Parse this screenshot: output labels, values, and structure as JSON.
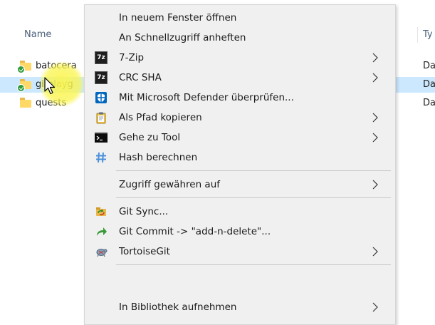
{
  "explorer": {
    "columns": {
      "name": "Name",
      "type": "Ty"
    },
    "rows": [
      {
        "name": "batocera",
        "type": "Da",
        "synced": true,
        "selected": false
      },
      {
        "name": "gitplayg",
        "type": "Da",
        "synced": true,
        "selected": true
      },
      {
        "name": "quests",
        "type": "Da",
        "synced": false,
        "selected": false
      }
    ]
  },
  "context_menu": {
    "items": [
      {
        "label": "In neuem Fenster öffnen",
        "icon": null,
        "submenu": false
      },
      {
        "label": "An Schnellzugriff anheften",
        "icon": null,
        "submenu": false
      },
      {
        "label": "7-Zip",
        "icon": "7zip-icon",
        "submenu": true
      },
      {
        "label": "CRC SHA",
        "icon": "7zip-icon",
        "submenu": true
      },
      {
        "label": "Mit Microsoft Defender überprüfen...",
        "icon": "defender-shield-icon",
        "submenu": false
      },
      {
        "label": "Als Pfad kopieren",
        "icon": "clipboard-icon",
        "submenu": true
      },
      {
        "label": "Gehe zu Tool",
        "icon": "terminal-icon",
        "submenu": true
      },
      {
        "label": "Hash berechnen",
        "icon": "hash-icon",
        "submenu": false
      },
      {
        "label": "Zugriff gewähren auf",
        "icon": null,
        "submenu": true
      },
      {
        "label": "Git Sync...",
        "icon": "git-sync-icon",
        "submenu": false
      },
      {
        "label": "Git Commit -> \"add-n-delete\"...",
        "icon": "git-commit-icon",
        "submenu": false
      },
      {
        "label": "TortoiseGit",
        "icon": "tortoisegit-icon",
        "submenu": true
      },
      {
        "label": "In Bibliothek aufnehmen",
        "icon": null,
        "submenu": true
      }
    ],
    "icon_text": {
      "zip7": "7z"
    }
  },
  "colors": {
    "selection": "#cce8ff",
    "menu_bg": "#f0f0f0",
    "folder": "#ffd866",
    "sync_badge": "#2e9a3a",
    "click_highlight": "#faf550",
    "defender_blue": "#0067c0"
  }
}
